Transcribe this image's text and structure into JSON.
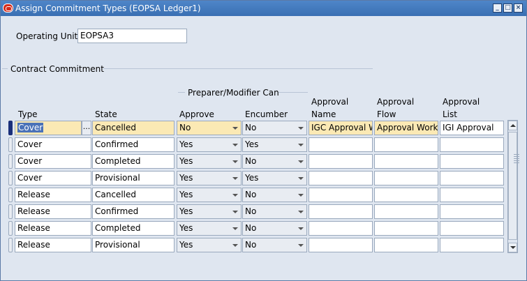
{
  "window": {
    "title": "Assign Commitment Types (EOPSA Ledger1)",
    "buttons": [
      "minimize",
      "maximize",
      "close"
    ]
  },
  "operating_unit": {
    "label": "Operating Unit",
    "value": "EOPSA3"
  },
  "section": {
    "title": "Contract Commitment",
    "group_header": "Preparer/Modifier Can"
  },
  "columns": {
    "type": "Type",
    "state": "State",
    "approve": "Approve",
    "encumber": "Encumber",
    "approval_name_1": "Approval",
    "approval_name_2": "Name",
    "approval_flow_1": "Approval",
    "approval_flow_2": "Flow",
    "approval_list_1": "Approval",
    "approval_list_2": "List"
  },
  "rows": [
    {
      "type": "Cover",
      "state": "Cancelled",
      "approve": "No",
      "encumber": "No",
      "approval_name": "IGC Approval W",
      "approval_flow": "Approval Workfl",
      "approval_list": "IGI Approval"
    },
    {
      "type": "Cover",
      "state": "Confirmed",
      "approve": "Yes",
      "encumber": "Yes",
      "approval_name": "",
      "approval_flow": "",
      "approval_list": ""
    },
    {
      "type": "Cover",
      "state": "Completed",
      "approve": "Yes",
      "encumber": "No",
      "approval_name": "",
      "approval_flow": "",
      "approval_list": ""
    },
    {
      "type": "Cover",
      "state": "Provisional",
      "approve": "Yes",
      "encumber": "Yes",
      "approval_name": "",
      "approval_flow": "",
      "approval_list": ""
    },
    {
      "type": "Release",
      "state": "Cancelled",
      "approve": "Yes",
      "encumber": "No",
      "approval_name": "",
      "approval_flow": "",
      "approval_list": ""
    },
    {
      "type": "Release",
      "state": "Confirmed",
      "approve": "Yes",
      "encumber": "No",
      "approval_name": "",
      "approval_flow": "",
      "approval_list": ""
    },
    {
      "type": "Release",
      "state": "Completed",
      "approve": "Yes",
      "encumber": "No",
      "approval_name": "",
      "approval_flow": "",
      "approval_list": ""
    },
    {
      "type": "Release",
      "state": "Provisional",
      "approve": "Yes",
      "encumber": "No",
      "approval_name": "",
      "approval_flow": "",
      "approval_list": ""
    }
  ],
  "lov_button": "...",
  "colors": {
    "titlebar": "#3a6fb3",
    "highlight": "#fbe9b4",
    "selection": "#4b72b8",
    "row_indicator_active": "#1a2f7a"
  }
}
